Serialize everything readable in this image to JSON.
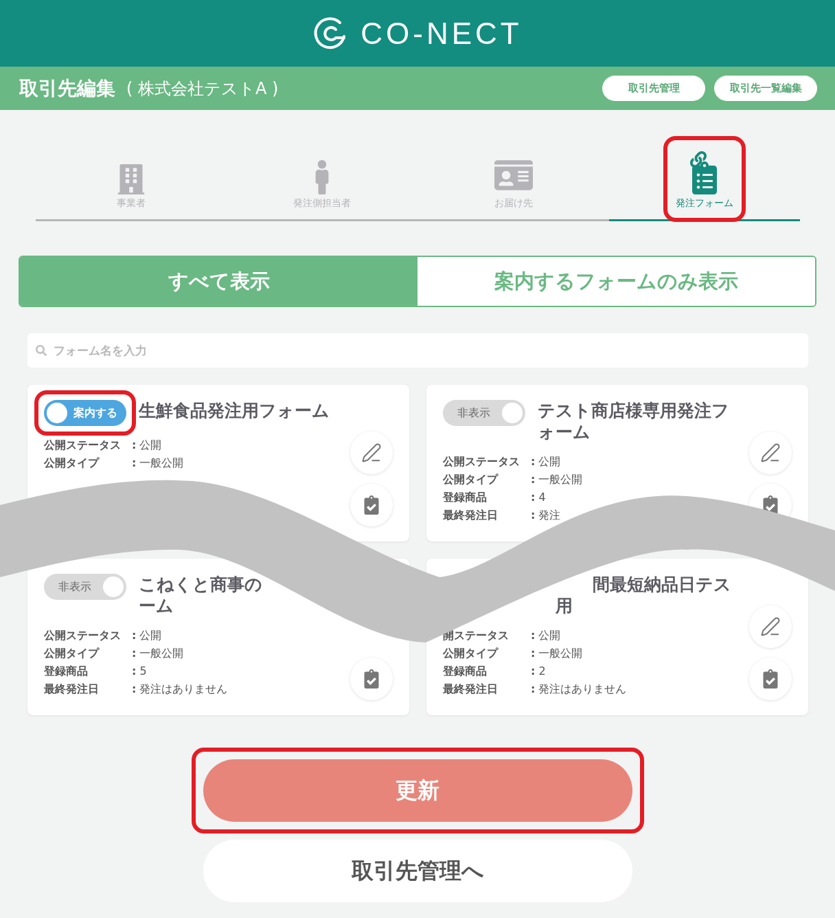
{
  "header": {
    "logo_text": "CO-NECT"
  },
  "title_bar": {
    "title": "取引先編集",
    "subtitle": "( 株式会社テストA )",
    "buttons": [
      "取引先管理",
      "取引先一覧編集"
    ]
  },
  "tabs": [
    {
      "label": "事業者",
      "selected": false,
      "highlighted": false
    },
    {
      "label": "発注側担当者",
      "selected": false,
      "highlighted": false
    },
    {
      "label": "お届け先",
      "selected": false,
      "highlighted": false
    },
    {
      "label": "発注フォーム",
      "selected": true,
      "highlighted": true
    }
  ],
  "filter": [
    {
      "label": "すべて表示",
      "selected": true
    },
    {
      "label": "案内するフォームのみ表示",
      "selected": false
    }
  ],
  "search": {
    "placeholder": "フォーム名を入力"
  },
  "cards": [
    {
      "toggle": {
        "label": "案内する",
        "on": true,
        "highlighted": true
      },
      "title_lines": [
        "生鮮食品発注用フォーム"
      ],
      "rows": [
        {
          "label": "公開ステータス",
          "value": "**:** 公開"
        },
        {
          "label": "公開タイプ",
          "value": "**:** 一般公開"
        }
      ],
      "edit": true,
      "check": true
    },
    {
      "toggle": {
        "label": "非表示",
        "on": false,
        "highlighted": false
      },
      "title_lines": [
        "テスト商店様専用発注フ",
        "ォーム"
      ],
      "rows": [
        {
          "label": "公開ステータス",
          "value": "**:** 公開"
        },
        {
          "label": "公開タイプ",
          "value": "**:** 一般公開"
        },
        {
          "label": "登録商品",
          "value": "**:** 4"
        },
        {
          "label": "最終発注日",
          "value": "**:** 発注"
        }
      ],
      "edit": true,
      "check": true
    },
    {
      "toggle": {
        "label": "非表示",
        "on": false,
        "highlighted": false
      },
      "title_lines": [
        "こねくと商事の",
        "ーム"
      ],
      "rows": [
        {
          "label": "公開ステータス",
          "value": "**:** 公開"
        },
        {
          "label": "公開タイプ",
          "value": "**:** 一般公開"
        },
        {
          "label": "登録商品",
          "value": "**:** 5"
        },
        {
          "label": "最終発注日",
          "value": "**:** 発注はありません"
        }
      ],
      "edit": false,
      "check": true
    },
    {
      "title_lines": [
        "間最短納品日テス",
        "用"
      ],
      "rows": [
        {
          "label": "開ステータス",
          "value": "**:** 公開"
        },
        {
          "label": "公開タイプ",
          "value": "**:** 一般公開"
        },
        {
          "label": "登録商品",
          "value": "**:** 2"
        },
        {
          "label": "最終発注日",
          "value": "**:** 発注はありません"
        }
      ],
      "edit": true,
      "check": true
    }
  ],
  "actions": [
    {
      "label": "更新",
      "kind": "primary",
      "highlighted": true
    },
    {
      "label": "取引先管理へ",
      "kind": "secondary",
      "highlighted": false
    }
  ]
}
